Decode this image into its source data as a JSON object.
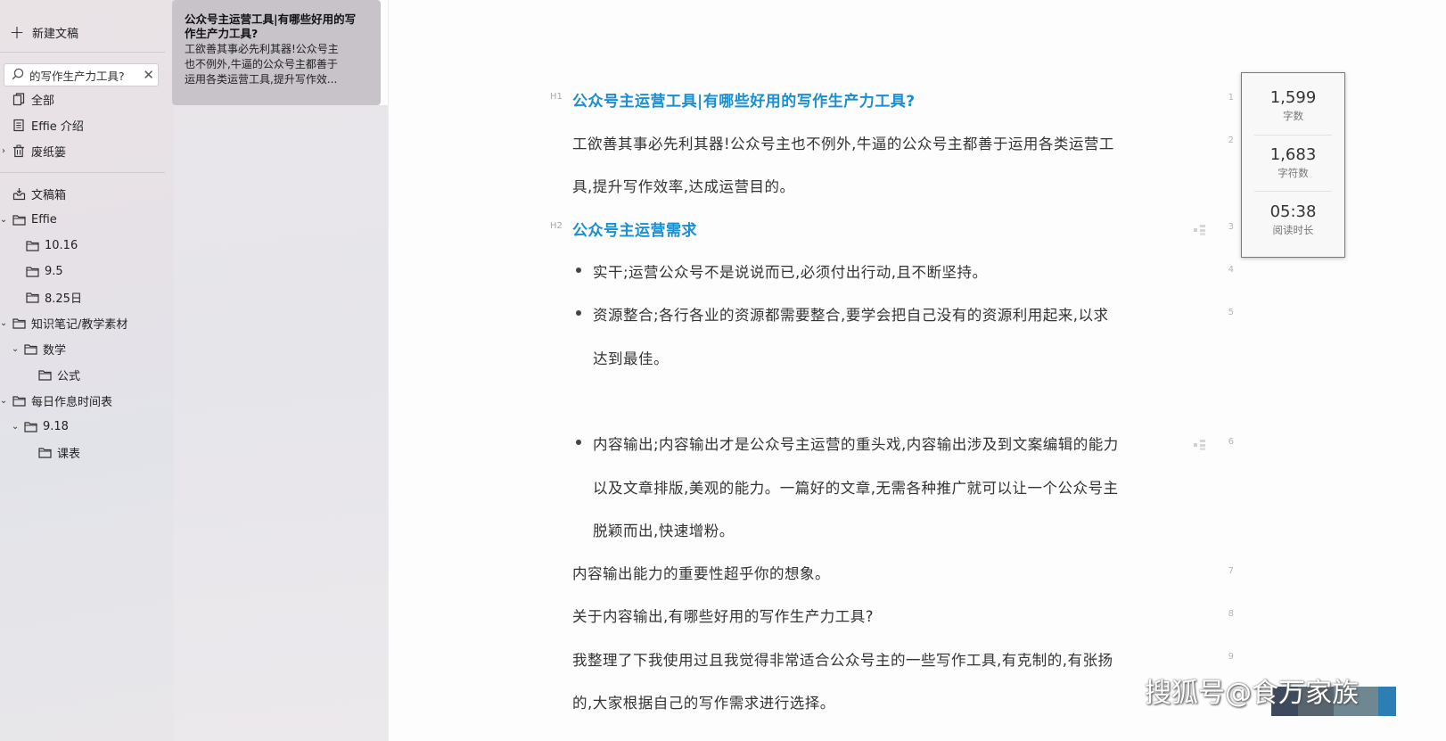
{
  "sidebar": {
    "new_doc_label": "新建文稿",
    "search": {
      "value": "的写作生产力工具?",
      "placeholder": "",
      "clear_icon": "close-icon"
    },
    "library_items": [
      {
        "label": "全部",
        "icon": "documents-icon"
      },
      {
        "label": "Effie 介绍",
        "icon": "document-icon"
      },
      {
        "label": "废纸篓",
        "icon": "trash-icon"
      }
    ],
    "folders": [
      {
        "label": "文稿箱",
        "icon": "inbox-icon"
      },
      {
        "label": "Effie",
        "icon": "folder-icon"
      },
      {
        "label": "10.16",
        "icon": "folder-icon"
      },
      {
        "label": "9.5",
        "icon": "folder-icon"
      },
      {
        "label": "8.25日",
        "icon": "folder-icon"
      },
      {
        "label": "知识笔记/教学素材",
        "icon": "folder-icon"
      },
      {
        "label": "数学",
        "icon": "folder-icon"
      },
      {
        "label": "公式",
        "icon": "folder-icon"
      },
      {
        "label": "每日作息时间表",
        "icon": "folder-icon"
      },
      {
        "label": "9.18",
        "icon": "folder-icon"
      },
      {
        "label": "课表",
        "icon": "folder-icon"
      }
    ]
  },
  "result_card": {
    "title_line1": "公众号主运营工具|有哪些好用的写",
    "title_line2": "作生产力工具?",
    "snippet_line1": "工欲善其事必先利其器!公众号主",
    "snippet_line2": "也不例外,牛逼的公众号主都善于",
    "snippet_line3": "运用各类运营工具,提升写作效..."
  },
  "editor": {
    "h1_tag": "H1",
    "h2_tag": "H2",
    "lines": {
      "l1": "公众号主运营工具|有哪些好用的写作生产力工具?",
      "l2a": "工欲善其事必先利其器!公众号主也不例外,牛逼的公众号主都善于运用各类运营工",
      "l2b": "具,提升写作效率,达成运营目的。",
      "l3": "公众号主运营需求",
      "l4": "实干;运营公众号不是说说而已,必须付出行动,且不断坚持。",
      "l5a": "资源整合;各行各业的资源都需要整合,要学会把自己没有的资源利用起来,以求",
      "l5b": "达到最佳。",
      "l6a": "内容输出;内容输出才是公众号主运营的重头戏,内容输出涉及到文案编辑的能力",
      "l6b": "以及文章排版,美观的能力。一篇好的文章,无需各种推广就可以让一个公众号主",
      "l6c": "脱颖而出,快速增粉。",
      "l7": "内容输出能力的重要性超乎你的想象。",
      "l8": "关于内容输出,有哪些好用的写作生产力工具?",
      "l9a": "我整理了下我使用过且我觉得非常适合公众号主的一些写作工具,有克制的,有张扬",
      "l9b": "的,大家根据自己的写作需求进行选择。"
    },
    "line_numbers": [
      "1",
      "2",
      "3",
      "4",
      "5",
      "6",
      "7",
      "8",
      "9"
    ]
  },
  "stats": {
    "words": {
      "value": "1,599",
      "label": "字数"
    },
    "chars": {
      "value": "1,683",
      "label": "字符数"
    },
    "reading": {
      "value": "05:38",
      "label": "阅读时长"
    }
  },
  "watermark": {
    "text": "搜狐号@食万家族"
  },
  "colors": {
    "heading": "#1a8fd0",
    "sidebar_bg": "#e6e1e6",
    "card_bg": "#c7c3c9"
  }
}
